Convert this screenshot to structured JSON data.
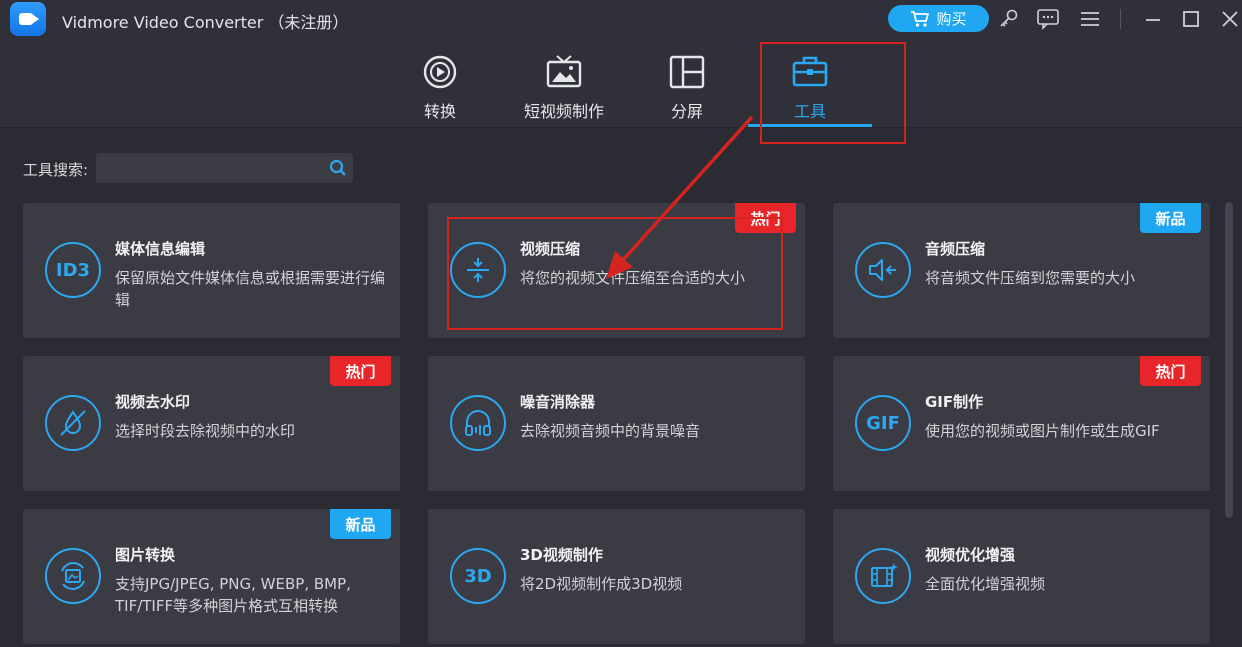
{
  "window": {
    "title": "Vidmore Video Converter （未注册）",
    "buy_label": "购买",
    "icons": [
      "key-icon",
      "feedback-icon",
      "menu-icon",
      "minimize-icon",
      "maximize-icon",
      "close-icon"
    ]
  },
  "nav": {
    "tabs": [
      {
        "label": "转换",
        "icon": "convert-icon"
      },
      {
        "label": "短视频制作",
        "icon": "mv-icon"
      },
      {
        "label": "分屏",
        "icon": "collage-icon"
      },
      {
        "label": "工具",
        "icon": "toolbox-icon",
        "active": true
      }
    ]
  },
  "search": {
    "label": "工具搜索:",
    "value": "",
    "placeholder": ""
  },
  "tools": [
    {
      "title": "媒体信息编辑",
      "desc": "保留原始文件媒体信息或根据需要进行编辑",
      "icon": "id3-icon",
      "icon_text": "ID3",
      "badge": ""
    },
    {
      "title": "视频压缩",
      "desc": "将您的视频文件压缩至合适的大小",
      "icon": "compress-icon",
      "badge": "热门"
    },
    {
      "title": "音频压缩",
      "desc": "将音频文件压缩到您需要的大小",
      "icon": "audio-compress-icon",
      "badge": "新品"
    },
    {
      "title": "视频去水印",
      "desc": "选择时段去除视频中的水印",
      "icon": "watermark-icon",
      "badge": "热门"
    },
    {
      "title": "噪音消除器",
      "desc": "去除视频音频中的背景噪音",
      "icon": "headphones-icon",
      "badge": ""
    },
    {
      "title": "GIF制作",
      "desc": "使用您的视频或图片制作或生成GIF",
      "icon": "gif-icon",
      "icon_text": "GIF",
      "badge": "热门"
    },
    {
      "title": "图片转换",
      "desc": "支持JPG/JPEG, PNG, WEBP, BMP, TIF/TIFF等多种图片格式互相转换",
      "icon": "image-convert-icon",
      "badge": "新品"
    },
    {
      "title": "3D视频制作",
      "desc": "将2D视频制作成3D视频",
      "icon": "3d-icon",
      "icon_text": "3D",
      "badge": ""
    },
    {
      "title": "视频优化增强",
      "desc": "全面优化增强视频",
      "icon": "enhance-icon",
      "badge": ""
    }
  ],
  "colors": {
    "accent": "#24a6f0",
    "hot": "#e8262a",
    "new": "#1fa7f2",
    "annotation": "#d5231f",
    "card": "#3a3b43",
    "background": "#2b2c33"
  }
}
